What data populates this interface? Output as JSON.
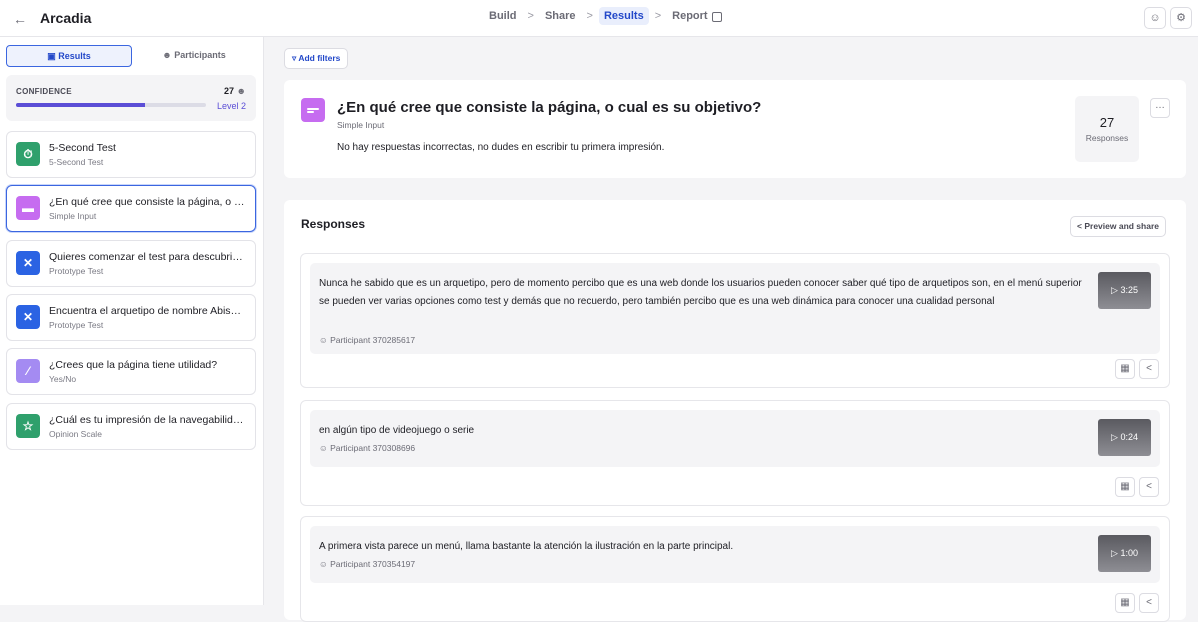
{
  "header": {
    "back_icon": "arrow-left-icon",
    "title": "Arcadia",
    "nav": [
      "Build",
      "Share",
      "Results",
      "Report"
    ],
    "nav_active": "Results",
    "user_icon": "user-icon",
    "settings_icon": "gear-icon"
  },
  "sidebar": {
    "tabs": [
      {
        "label": "Results",
        "icon": "results-icon"
      },
      {
        "label": "Participants",
        "icon": "participants-icon"
      }
    ],
    "confidence": {
      "label": "CONFIDENCE",
      "count": "27",
      "level": "Level 2",
      "progress": 0.68
    },
    "items": [
      {
        "title": "5-Second Test",
        "subtitle": "5-Second Test",
        "color": "#2fa06c",
        "icon": "timer-icon",
        "glyph": "⏱"
      },
      {
        "title": "¿En qué cree que consiste la página, o cual es su objetivo?",
        "subtitle": "Simple Input",
        "color": "#c66cf0",
        "icon": "text-input-icon",
        "glyph": "▬"
      },
      {
        "title": "Quieres comenzar el test para descubrir tu arquetipo",
        "subtitle": "Prototype Test",
        "color": "#2b63e3",
        "icon": "prototype-icon",
        "glyph": "✕"
      },
      {
        "title": "Encuentra el arquetipo de nombre Abismo",
        "subtitle": "Prototype Test",
        "color": "#2b63e3",
        "icon": "prototype-icon",
        "glyph": "✕"
      },
      {
        "title": "¿Crees que la página tiene utilidad?",
        "subtitle": "Yes/No",
        "color": "#a48bf2",
        "icon": "yes-no-icon",
        "glyph": "⁄"
      },
      {
        "title": "¿Cuál es tu impresión de la navegabilidad?",
        "subtitle": "Opinion Scale",
        "color": "#2fa06c",
        "icon": "star-icon",
        "glyph": "☆"
      }
    ]
  },
  "main": {
    "add_filters": "Add filters",
    "question": {
      "title": "¿En qué cree que consiste la página, o cual es su objetivo?",
      "type": "Simple Input",
      "description": "No hay respuestas incorrectas, no dudes en escribir tu primera impresión.",
      "responses_count": "27",
      "responses_label": "Responses"
    },
    "responses_title": "Responses",
    "preview_share": "Preview and share",
    "responses": [
      {
        "text": "Nunca he sabido que es un arquetipo, pero de momento percibo que es una web donde los usuarios pueden conocer saber qué tipo de arquetipos son, en el menú superior se pueden ver varias opciones como test y demás que no recuerdo, pero también percibo que es una web dinámica para conocer una cualidad personal",
        "participant": "Participant 370285617",
        "duration": "3:25"
      },
      {
        "text": "en algún tipo de videojuego o serie",
        "participant": "Participant 370308696",
        "duration": "0:24"
      },
      {
        "text": "A primera vista parece un menú, llama bastante la atención la ilustración en la parte principal.",
        "participant": "Participant 370354197",
        "duration": "1:00"
      }
    ]
  }
}
